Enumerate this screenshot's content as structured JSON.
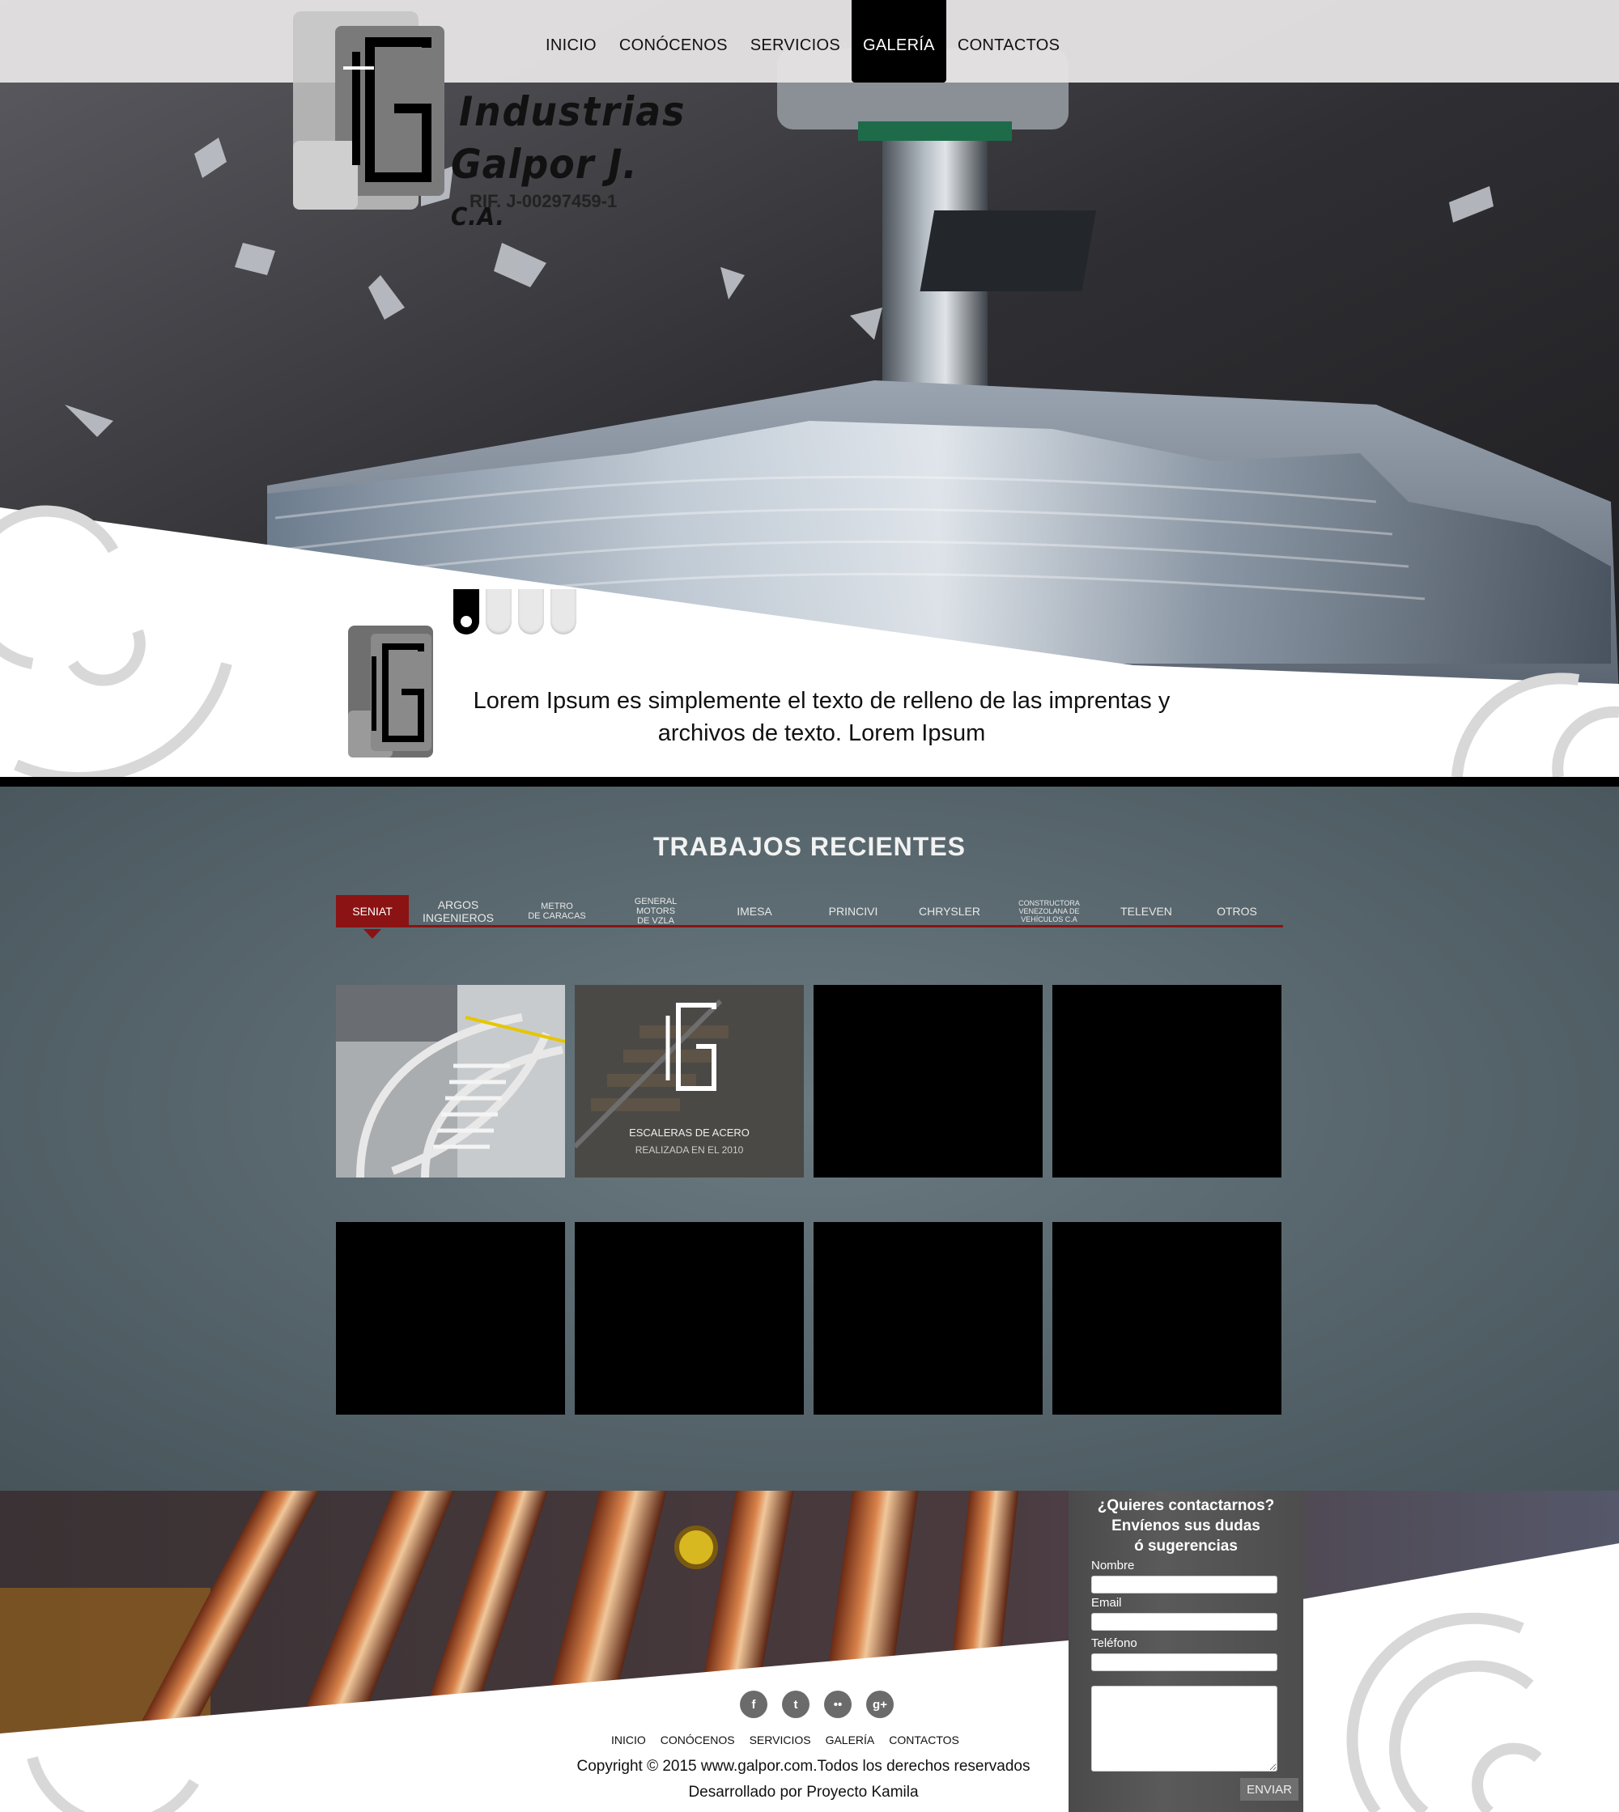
{
  "nav": {
    "items": [
      "INICIO",
      "CONÓCENOS",
      "SERVICIOS",
      "GALERÍA",
      "CONTACTOS"
    ],
    "active": "GALERÍA"
  },
  "logo": {
    "line1": "Industrias",
    "line2": "Galpor J.",
    "suffix": "C.A.",
    "rif": "RIF. J-00297459-1"
  },
  "hero": {
    "tagline": "Lorem Ipsum es simplemente el texto de relleno de las imprentas y archivos de texto. Lorem Ipsum",
    "slides": 4,
    "active_slide": 1
  },
  "gallery": {
    "title": "TRABAJOS RECIENTES",
    "tabs": [
      {
        "label": "SENIAT",
        "active": true
      },
      {
        "label": "ARGOS\nINGENIEROS"
      },
      {
        "label": "METRO\nDE CARACAS"
      },
      {
        "label": "GENERAL\nMOTORS\nDE VZLA"
      },
      {
        "label": "IMESA"
      },
      {
        "label": "PRINCIVI"
      },
      {
        "label": "CHRYSLER"
      },
      {
        "label": "CONSTRUCTORA\nVENEZOLANA DE\nVEHÍCULOS C.A"
      },
      {
        "label": "TELEVEN"
      },
      {
        "label": "OTROS"
      }
    ],
    "hover_tile": {
      "title": "ESCALERAS DE ACERO",
      "subtitle": "REALIZADA EN EL 2010"
    }
  },
  "contact": {
    "title": "¿Quieres contactarnos?\nEnvíenos sus dudas\nó sugerencias",
    "name_label": "Nombre",
    "email_label": "Email",
    "phone_label": "Teléfono",
    "submit": "ENVIAR"
  },
  "footer": {
    "social": [
      "f",
      "t",
      "••",
      "g+"
    ],
    "social_icons": [
      "facebook-icon",
      "twitter-icon",
      "flickr-icon",
      "google-plus-icon"
    ],
    "nav": [
      "INICIO",
      "CONÓCENOS",
      "SERVICIOS",
      "GALERÍA",
      "CONTACTOS"
    ],
    "copyright": "Copyright © 2015 www.galpor.com.Todos los derechos reservados",
    "developer": "Desarrollado por Proyecto Kamila"
  }
}
